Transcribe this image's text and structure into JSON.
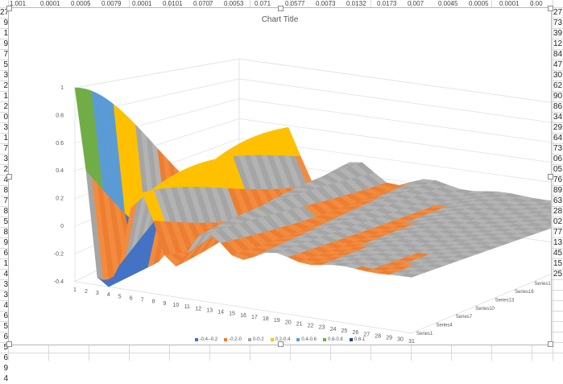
{
  "spreadsheet": {
    "left_column_values": [
      "27",
      "9",
      "1",
      "9",
      "7",
      "5",
      "3",
      "2",
      "1",
      "2",
      "0",
      "3",
      "1",
      "7",
      "3",
      "2",
      "4",
      "8",
      "7",
      "8",
      "5",
      "8",
      "9",
      "6",
      "1",
      "4",
      "3",
      "3",
      "4",
      "6",
      "5",
      "6",
      "5",
      "6",
      "9",
      "4"
    ],
    "right_column_values": [
      "27",
      "73",
      "39",
      "12",
      "84",
      "47",
      "30",
      "62",
      "90",
      "86",
      "34",
      "29",
      "64",
      "73",
      "06",
      "05",
      "76",
      "89",
      "63",
      "28",
      "02",
      "77",
      "13",
      "45",
      "15",
      "25"
    ],
    "top_row_values": [
      "1.001",
      "0.0001",
      "0.0005",
      "0.0079",
      "0.0001",
      "0.0101",
      "0.0707",
      "0.0053",
      "0.071",
      "0.0577",
      "0.0073",
      "0.0132",
      "0.0173",
      "0.007",
      "0.0045",
      "0.0005",
      "0.0001",
      "0.00"
    ]
  },
  "chart": {
    "title": "Chart Title",
    "z_ticks": [
      "1",
      "0.8",
      "0.6",
      "0.4",
      "0.2",
      "0",
      "-0.2",
      "-0.4"
    ],
    "x_ticks": [
      "1",
      "2",
      "3",
      "4",
      "5",
      "6",
      "7",
      "8",
      "9",
      "10",
      "11",
      "12",
      "13",
      "14",
      "15",
      "16",
      "17",
      "18",
      "19",
      "20",
      "21",
      "22",
      "23",
      "24",
      "25",
      "26",
      "27",
      "28",
      "29",
      "30",
      "31"
    ],
    "series_ticks": [
      "Series1",
      "Series4",
      "Series7",
      "Series10",
      "Series13",
      "Series16",
      "Series19",
      "Series22",
      "Series25",
      "Series28",
      "Series31"
    ],
    "legend": [
      {
        "label": "-0.4--0.2",
        "color": "#4472c4"
      },
      {
        "label": "-0.2-0",
        "color": "#ed7d31"
      },
      {
        "label": "0-0.2",
        "color": "#a5a5a5"
      },
      {
        "label": "0.2-0.4",
        "color": "#ffc000"
      },
      {
        "label": "0.4-0.6",
        "color": "#5b9bd5"
      },
      {
        "label": "0.6-0.8",
        "color": "#70ad47"
      },
      {
        "label": "0.8-1",
        "color": "#264478"
      }
    ]
  },
  "chart_data": {
    "type": "surface",
    "title": "Chart Title",
    "x": [
      1,
      2,
      3,
      4,
      5,
      6,
      7,
      8,
      9,
      10,
      11,
      12,
      13,
      14,
      15,
      16,
      17,
      18,
      19,
      20,
      21,
      22,
      23,
      24,
      25,
      26,
      27,
      28,
      29,
      30,
      31
    ],
    "series": [
      "Series1",
      "Series4",
      "Series7",
      "Series10",
      "Series13",
      "Series16",
      "Series19",
      "Series22",
      "Series25",
      "Series28",
      "Series31"
    ],
    "zlim": [
      -0.4,
      1
    ],
    "z_ticks": [
      -0.4,
      -0.2,
      0,
      0.2,
      0.4,
      0.6,
      0.8,
      1
    ],
    "note_values_series1": [
      1.0,
      0.72,
      0.2,
      -0.17,
      -0.09,
      0.13,
      0.2,
      0.08,
      -0.07,
      -0.09,
      0.0,
      0.08,
      0.06,
      -0.03,
      -0.06,
      -0.01,
      0.04,
      0.04,
      -0.01,
      -0.04,
      -0.02,
      0.02,
      0.03,
      0.0,
      -0.03,
      -0.02,
      0.01,
      0.02,
      0.0,
      -0.02,
      -0.01
    ]
  }
}
